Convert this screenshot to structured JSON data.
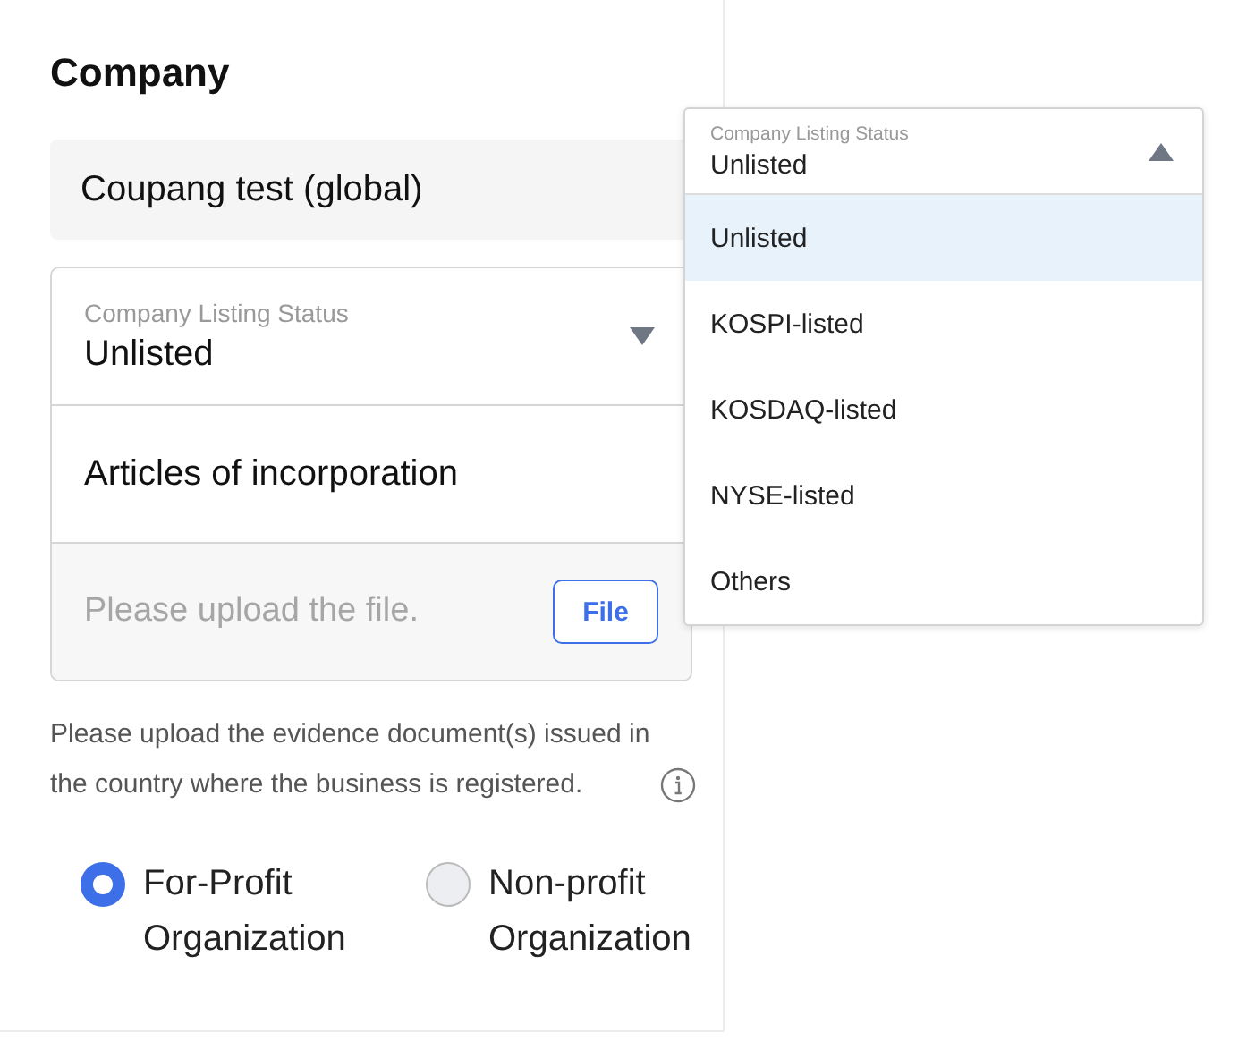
{
  "company": {
    "title": "Company",
    "name_field": {
      "value": "Coupang test (global)"
    },
    "listing_select": {
      "label": "Company Listing Status",
      "value": "Unlisted",
      "expanded": false
    },
    "document": {
      "title": "Articles of incorporation",
      "upload": {
        "placeholder": "Please upload the file.",
        "button": "File"
      }
    },
    "help_text": "Please upload the evidence document(s) issued in the country where the business is registered.",
    "organization_types": [
      {
        "label": "For-Profit Organization",
        "selected": true
      },
      {
        "label": "Non-profit Organization",
        "selected": false
      }
    ]
  },
  "listing_dropdown": {
    "label": "Company Listing Status",
    "value": "Unlisted",
    "expanded": true,
    "options": [
      {
        "label": "Unlisted",
        "selected": true
      },
      {
        "label": "KOSPI-listed",
        "selected": false
      },
      {
        "label": "KOSDAQ-listed",
        "selected": false
      },
      {
        "label": "NYSE-listed",
        "selected": false
      },
      {
        "label": "Others",
        "selected": false
      }
    ]
  }
}
